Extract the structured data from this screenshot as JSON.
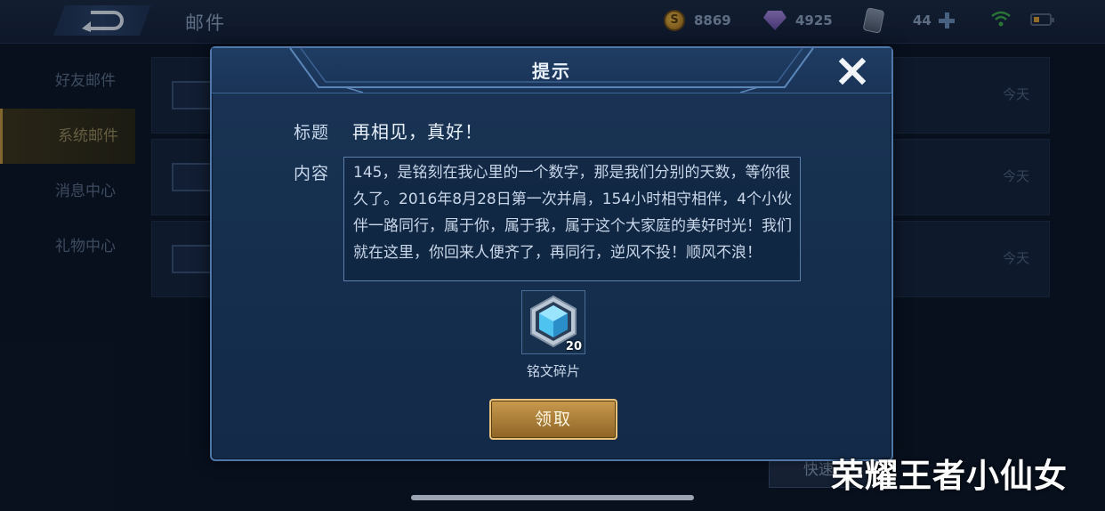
{
  "topbar": {
    "title": "邮件",
    "gold": "8869",
    "gems": "4925",
    "cards": "44"
  },
  "sidebar": {
    "items": [
      {
        "label": "好友邮件",
        "active": false
      },
      {
        "label": "系统邮件",
        "active": true
      },
      {
        "label": "消息中心",
        "active": false
      },
      {
        "label": "礼物中心",
        "active": false
      }
    ]
  },
  "mail_list": {
    "items": [
      {
        "day": "今天"
      },
      {
        "day": "今天"
      },
      {
        "day": "今天"
      }
    ],
    "quick_button": "快速"
  },
  "dialog": {
    "title": "提示",
    "subject_label": "标题",
    "subject": "再相见，真好！",
    "content_label": "内容",
    "content": "145，是铭刻在我心里的一个数字，那是我们分别的天数，等你很久了。2016年8月28日第一次并肩，154小时相守相伴，4个小伙伴一路同行，属于你，属于我，属于这个大家庭的美好时光！我们就在这里，你回来人便齐了，再同行，逆风不投！顺风不浪！",
    "reward": {
      "name": "铭文碎片",
      "quantity": "20"
    },
    "claim_button": "领取"
  },
  "watermark": "荣耀王者小仙女",
  "colors": {
    "dialog_border": "#4f78a8",
    "claim_button": "#c99a4e",
    "crystal": "#4fc3f0"
  }
}
